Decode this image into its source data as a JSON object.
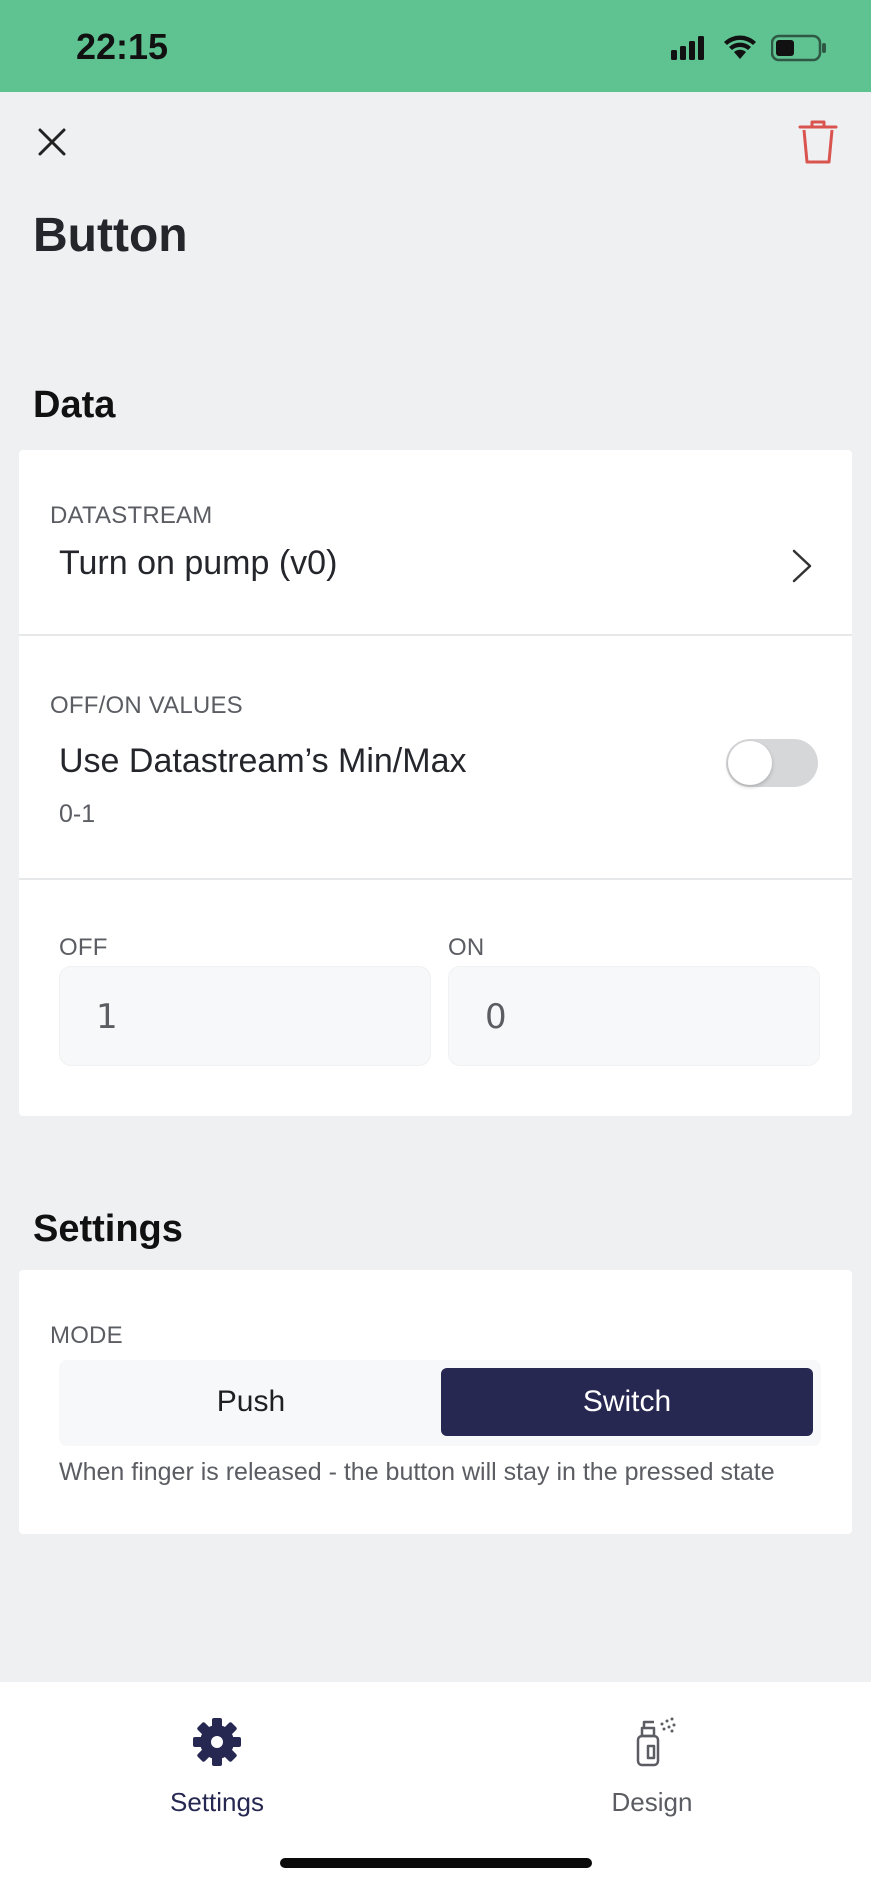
{
  "status_bar": {
    "time": "22:15"
  },
  "header": {
    "title": "Button",
    "close_icon": "close-icon",
    "delete_icon": "trash-icon"
  },
  "data_section": {
    "title": "Data",
    "datastream": {
      "caption": "DATASTREAM",
      "value": "Turn on pump (v0)"
    },
    "off_on_values": {
      "caption": "OFF/ON VALUES",
      "toggle_label": "Use Datastream’s Min/Max",
      "range": "0-1",
      "toggle_on": false
    },
    "off": {
      "label": "OFF",
      "value": "1"
    },
    "on": {
      "label": "ON",
      "value": "0"
    }
  },
  "settings_section": {
    "title": "Settings",
    "mode": {
      "caption": "MODE",
      "options": [
        "Push",
        "Switch"
      ],
      "selected": "Switch",
      "description": "When finger is released - the button will stay in the pressed state"
    }
  },
  "bottom_tabs": [
    {
      "label": "Settings",
      "icon": "gear-icon",
      "active": true
    },
    {
      "label": "Design",
      "icon": "spray-bottle-icon",
      "active": false
    }
  ],
  "colors": {
    "status_bar": "#5ec291",
    "accent": "#262852",
    "delete": "#d9534f"
  }
}
